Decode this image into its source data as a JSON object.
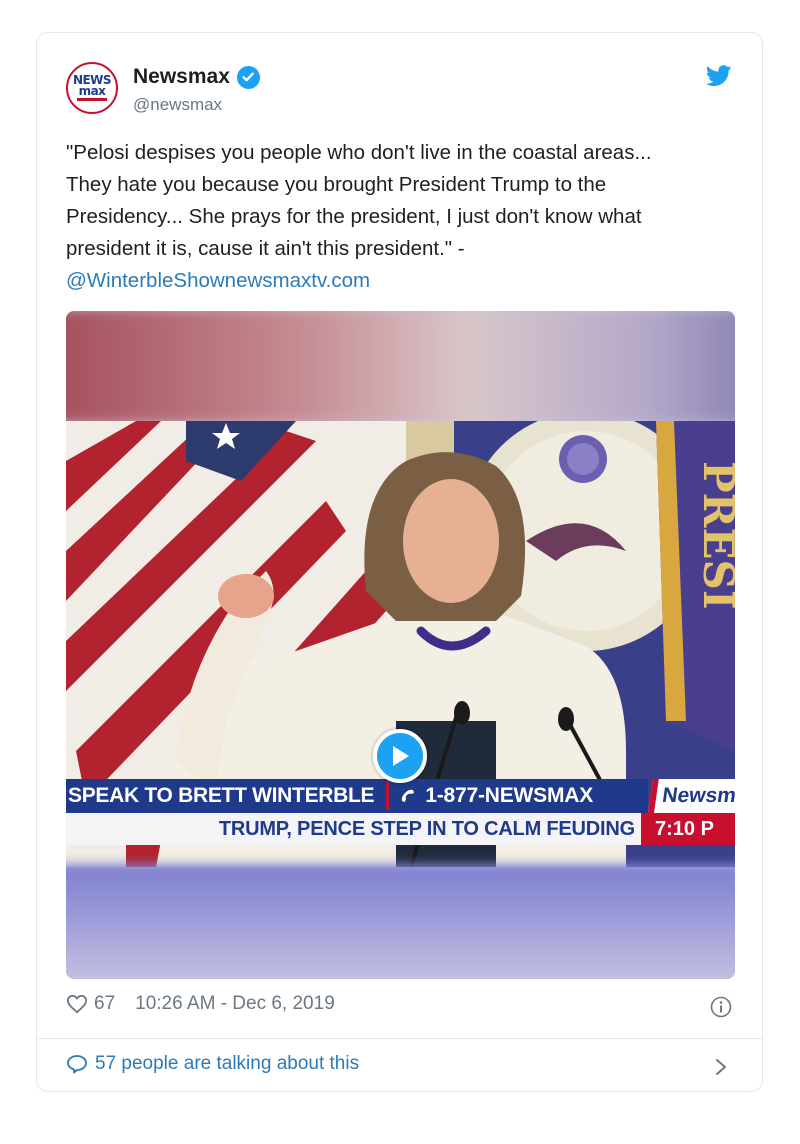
{
  "account": {
    "avatar_line1": "NEWS",
    "avatar_line2": "max",
    "name": "Newsmax",
    "handle": "@newsmax",
    "verified": true
  },
  "tweet": {
    "text": "\"Pelosi despises you people who don't live in the coastal areas...\nThey hate you because you brought President Trump to the\nPresidency... She prays for the president, I just don't know what\npresident it is, cause it ain't this president.\" -",
    "link": "@WinterbleShownewsmaxtv.com"
  },
  "video": {
    "chyron_top": "SPEAK TO BRETT WINTERBLE",
    "chyron_phone": "1-877-NEWSMAX",
    "chyron_logo": "Newsmax",
    "chyron_bottom": "TRUMP, PENCE STEP IN TO CALM FEUDING",
    "chyron_time": "7:10 P",
    "seal_text": "PRESI"
  },
  "footer": {
    "likes": "67",
    "timestamp": "10:26 AM - Dec 6, 2019",
    "talking": "57 people are talking about this"
  },
  "colors": {
    "twitter_blue": "#1da1f2",
    "link_blue": "#2b7bb9",
    "muted_gray": "#697882",
    "newsmax_navy": "#1f3a8a",
    "newsmax_red": "#c8102e"
  },
  "icons": [
    "verified-icon",
    "twitter-bird-icon",
    "play-icon",
    "phone-icon",
    "heart-icon",
    "info-icon",
    "comment-bubble-icon",
    "chevron-right-icon"
  ]
}
